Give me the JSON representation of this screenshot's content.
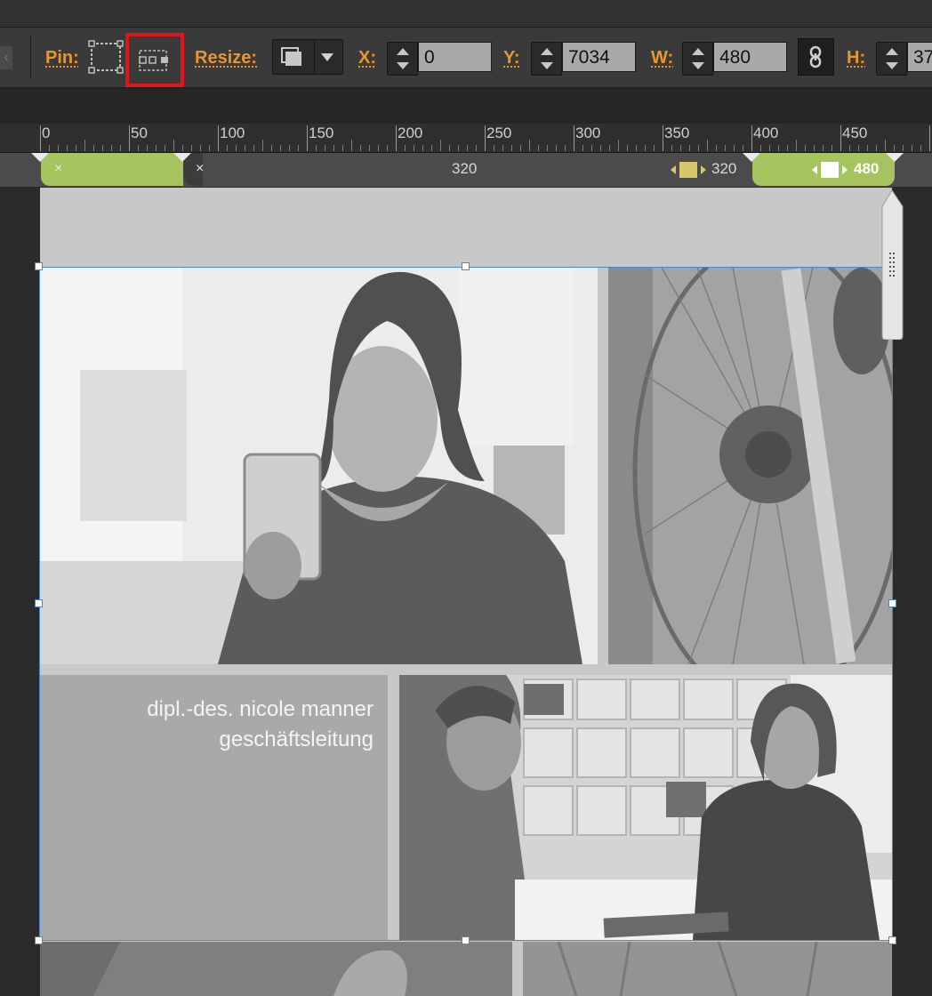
{
  "toolbar": {
    "scroll_glyph": "‹",
    "pin_label": "Pin:",
    "resize_label": "Resize:",
    "x_label": "X:",
    "x_value": "0",
    "y_label": "Y:",
    "y_value": "7034",
    "w_label": "W:",
    "w_value": "480",
    "h_label": "H:",
    "h_value": "37",
    "selected_pin_option": "pin-center-right"
  },
  "ruler": {
    "labels": [
      "0",
      "50",
      "100",
      "150",
      "200",
      "250",
      "300",
      "350",
      "400",
      "450"
    ]
  },
  "breakpoints": {
    "close_1": "×",
    "close_2": "×",
    "label_320": "320",
    "label_320b": "320",
    "label_480": "480"
  },
  "content": {
    "name_line": "dipl.-des. nicole manner",
    "title_line": "geschäftsleitung"
  },
  "colors": {
    "accent_orange": "#e8962e",
    "breakpoint_green": "#a5c45f",
    "selection_blue": "#4c84d6",
    "highlight_red": "#e0161b"
  }
}
